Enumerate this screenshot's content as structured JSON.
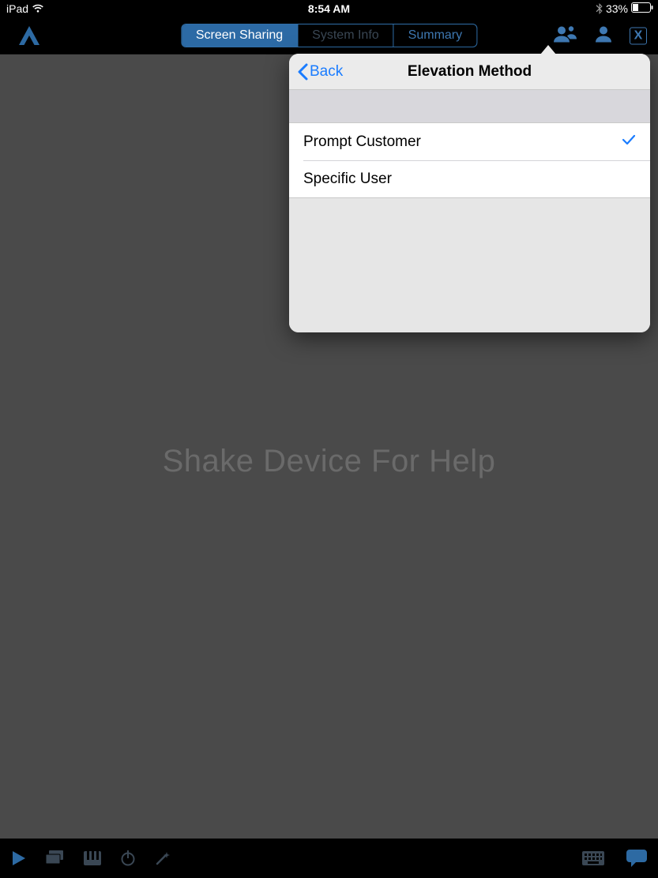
{
  "status": {
    "device": "iPad",
    "time": "8:54 AM",
    "battery_pct": "33%"
  },
  "toolbar": {
    "segments": {
      "screen_sharing": "Screen Sharing",
      "system_info": "System Info",
      "summary": "Summary"
    },
    "close_label": "X"
  },
  "main": {
    "help_text": "Shake Device For Help"
  },
  "popover": {
    "back_label": "Back",
    "title": "Elevation Method",
    "options": [
      {
        "label": "Prompt Customer",
        "selected": true
      },
      {
        "label": "Specific User",
        "selected": false
      }
    ]
  }
}
